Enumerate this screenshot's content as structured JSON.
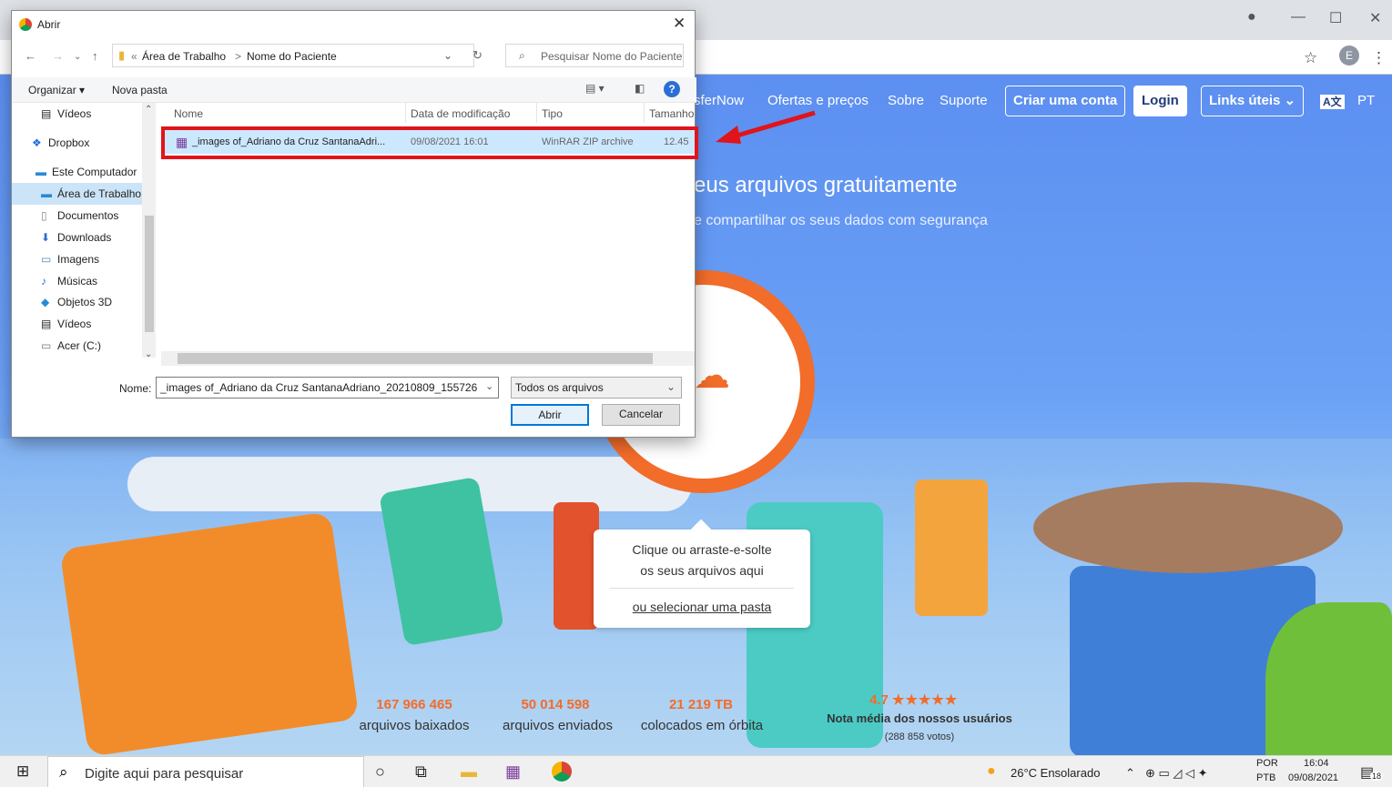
{
  "browser": {
    "window_controls": {
      "minimize": "—",
      "maximize": "☐",
      "close": "✕"
    },
    "profile_initial": "E"
  },
  "site": {
    "nav": [
      "sferNow",
      "Ofertas e preços",
      "Sobre",
      "Suporte"
    ],
    "create_account": "Criar uma conta",
    "login": "Login",
    "links": "Links úteis",
    "lang_badge": "A文",
    "lang": "PT",
    "hero_title": "eus arquivos gratuitamente",
    "hero_subtitle": "e compartilhar os seus dados com segurança",
    "drop_line1": "Clique ou arraste-e-solte",
    "drop_line2": "os seus arquivos aqui",
    "drop_folder": "ou selecionar uma pasta",
    "stats": [
      {
        "value": "167 966 465",
        "label": "arquivos baixados"
      },
      {
        "value": "50 014 598",
        "label": "arquivos enviados"
      },
      {
        "value": "21 219 TB",
        "label": "colocados em órbita"
      }
    ],
    "rating": {
      "value": "4.7",
      "stars": "★★★★★",
      "label": "Nota média dos nossos usuários",
      "votes": "(288 858 votos)"
    },
    "accent_color": "#f26c2a"
  },
  "dialog": {
    "title": "Abrir",
    "breadcrumb": [
      "«",
      "Área de Trabalho",
      ">",
      "Nome do Paciente"
    ],
    "search_placeholder": "Pesquisar Nome do Paciente",
    "organize": "Organizar ▾",
    "new_folder": "Nova pasta",
    "sidebar": [
      {
        "icon": "video-folder-icon",
        "label": "Vídeos"
      },
      {
        "icon": "dropbox-icon",
        "label": "Dropbox"
      },
      {
        "icon": "computer-icon",
        "label": "Este Computador"
      },
      {
        "icon": "desktop-icon",
        "label": "Área de Trabalho"
      },
      {
        "icon": "documents-icon",
        "label": "Documentos"
      },
      {
        "icon": "downloads-icon",
        "label": "Downloads"
      },
      {
        "icon": "images-icon",
        "label": "Imagens"
      },
      {
        "icon": "music-icon",
        "label": "Músicas"
      },
      {
        "icon": "3d-objects-icon",
        "label": "Objetos 3D"
      },
      {
        "icon": "video-folder-icon",
        "label": "Vídeos"
      },
      {
        "icon": "drive-icon",
        "label": "Acer (C:)"
      }
    ],
    "columns": [
      "Nome",
      "Data de modificação",
      "Tipo",
      "Tamanho"
    ],
    "files": [
      {
        "name": "_images of_Adriano da Cruz SantanaAdri...",
        "modified": "09/08/2021 16:01",
        "type": "WinRAR ZIP archive",
        "size": "12.45"
      }
    ],
    "name_label": "Nome:",
    "name_value": "_images of_Adriano da Cruz SantanaAdriano_20210809_155726",
    "filter": "Todos os arquivos",
    "open_button": "Abrir",
    "cancel_button": "Cancelar",
    "highlight_color": "#e0141a"
  },
  "taskbar": {
    "search_placeholder": "Digite aqui para pesquisar",
    "weather": "26°C Ensolarado",
    "lang_top": "POR",
    "lang_bottom": "PTB",
    "time": "16:04",
    "date": "09/08/2021",
    "notifications": "18"
  }
}
